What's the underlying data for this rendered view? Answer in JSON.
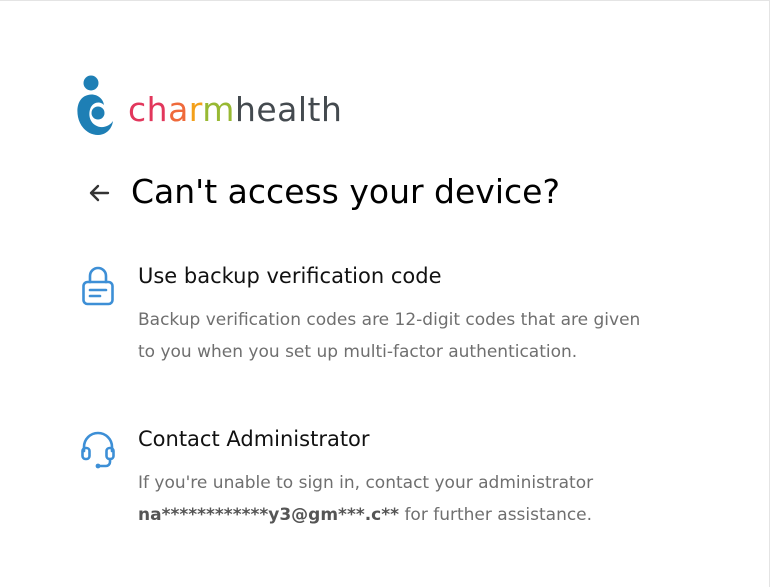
{
  "brand": {
    "name_parts": [
      "ch",
      "a",
      "r",
      "m",
      "health"
    ],
    "colors": [
      "#e2375c",
      "#ef6a3b",
      "#f3a01a",
      "#98b933",
      "#444a4f"
    ],
    "mark_color": "#1e7fb5"
  },
  "header": {
    "back_icon": "arrow-left-icon",
    "title": "Can't access your device?"
  },
  "options": [
    {
      "icon": "lock-icon",
      "title": "Use backup verification code",
      "desc_lines": [
        "Backup verification codes are 12-digit codes that are given",
        "to you when you set up multi-factor authentication."
      ]
    },
    {
      "icon": "headset-icon",
      "title": "Contact Administrator",
      "desc_line1": "If you're unable to sign in, contact your administrator",
      "email": "na************y3@gm***.c**",
      "desc_suffix": " for further assistance."
    }
  ],
  "accent_color": "#3d8fd6"
}
